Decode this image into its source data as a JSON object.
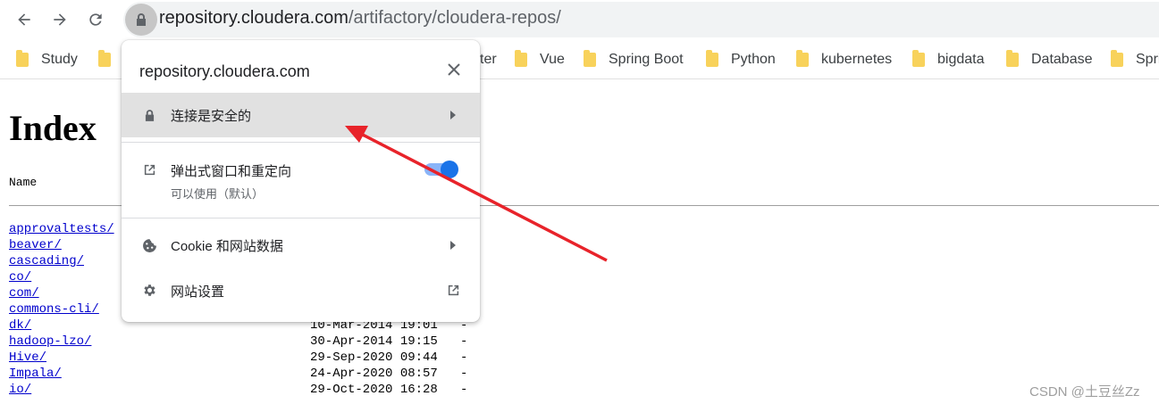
{
  "browser": {
    "url_host": "repository.cloudera.com",
    "url_path": "/artifactory/cloudera-repos/"
  },
  "bookmarks": [
    {
      "label": "Study"
    },
    {
      "label": "ter"
    },
    {
      "label": "Vue"
    },
    {
      "label": "Spring Boot"
    },
    {
      "label": "Python"
    },
    {
      "label": "kubernetes"
    },
    {
      "label": "bigdata"
    },
    {
      "label": "Database"
    },
    {
      "label": "Spri"
    }
  ],
  "page": {
    "title": "Index",
    "column_name": "Name",
    "rows": [
      {
        "name": "approvaltests/",
        "date": "",
        "size": ""
      },
      {
        "name": "beaver/",
        "date": "",
        "size": ""
      },
      {
        "name": "cascading/",
        "date": "",
        "size": ""
      },
      {
        "name": "co/",
        "date": "",
        "size": ""
      },
      {
        "name": "com/",
        "date": "",
        "size": ""
      },
      {
        "name": "commons-cli/",
        "date": "",
        "size": ""
      },
      {
        "name": "dk/",
        "date": "10-Mar-2014 19:01",
        "size": "-"
      },
      {
        "name": "hadoop-lzo/",
        "date": "30-Apr-2014 19:15",
        "size": "-"
      },
      {
        "name": "Hive/",
        "date": "29-Sep-2020 09:44",
        "size": "-"
      },
      {
        "name": "Impala/",
        "date": "24-Apr-2020 08:57",
        "size": "-"
      },
      {
        "name": "io/",
        "date": "29-Oct-2020 16:28",
        "size": "-"
      }
    ]
  },
  "popup": {
    "host": "repository.cloudera.com",
    "connection_secure": "连接是安全的",
    "popups_label": "弹出式窗口和重定向",
    "popups_sub": "可以使用（默认）",
    "popups_enabled": true,
    "cookies_label": "Cookie 和网站数据",
    "site_settings_label": "网站设置"
  },
  "watermark": "CSDN @土豆丝Zz",
  "colors": {
    "accent": "#1a73e8",
    "annotation_arrow": "#e8232a",
    "folder": "#f8d25b",
    "link": "#0000cc"
  }
}
